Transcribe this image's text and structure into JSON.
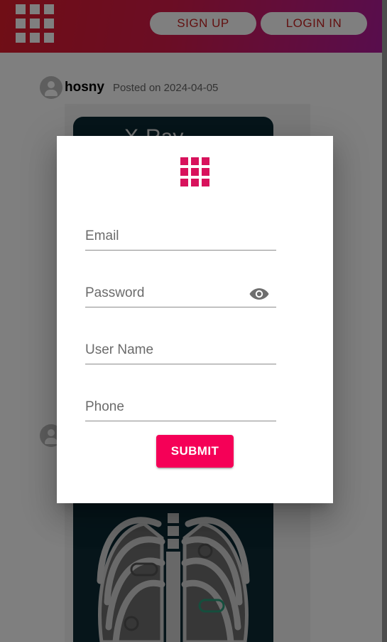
{
  "header": {
    "signup_label": "SIGN UP",
    "login_label": "LOGIN IN",
    "logo_icon": "grid-apps-icon"
  },
  "posts": [
    {
      "username": "hosny",
      "posted": "Posted on 2024-04-05",
      "image_title_fragment": "X-Ray..."
    }
  ],
  "modal": {
    "logo_icon": "grid-apps-icon",
    "fields": {
      "email_placeholder": "Email",
      "password_placeholder": "Password",
      "username_placeholder": "User Name",
      "phone_placeholder": "Phone"
    },
    "password_toggle_icon": "eye-icon",
    "submit_label": "SUBMIT"
  },
  "colors": {
    "header_gradient_start": "#e01c2c",
    "header_gradient_end": "#b01a9a",
    "accent": "#f50057",
    "logo": "#d8125c"
  }
}
